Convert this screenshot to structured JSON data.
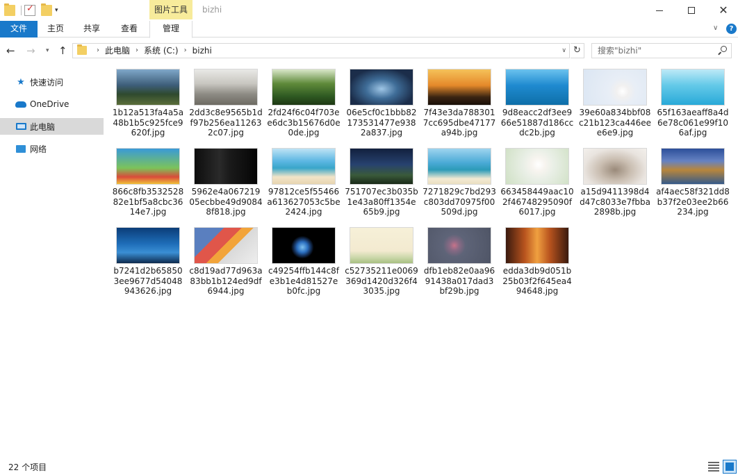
{
  "titlebar": {
    "context_tab": "图片工具",
    "title": "bizhi"
  },
  "ribbon": {
    "tabs": [
      "文件",
      "主页",
      "共享",
      "查看",
      "管理"
    ]
  },
  "address": {
    "crumbs": [
      "此电脑",
      "系统 (C:)",
      "bizhi"
    ],
    "search_placeholder": "搜索\"bizhi\""
  },
  "navpane": {
    "items": [
      "快速访问",
      "OneDrive",
      "此电脑",
      "网络"
    ],
    "selected": "此电脑"
  },
  "files": [
    {
      "name": "1b12a513fa4a5a48b1b5c925fce9620f.jpg"
    },
    {
      "name": "2dd3c8e9565b1df97b256ea112632c07.jpg"
    },
    {
      "name": "2fd24f6c04f703ee6dc3b15676d0e0de.jpg"
    },
    {
      "name": "06e5cf0c1bbb82173531477e9382a837.jpg"
    },
    {
      "name": "7f43e3da7883017cc695dbe47177a94b.jpg"
    },
    {
      "name": "9d8eacc2df3ee966e51887d186ccdc2b.jpg"
    },
    {
      "name": "39e60a834bbf08c21b123ca446eee6e9.jpg"
    },
    {
      "name": "65f163aeaff8a4d6e78c061e99f106af.jpg"
    },
    {
      "name": "866c8fb353252882e1bf5a8cbc3614e7.jpg"
    },
    {
      "name": "5962e4a06721905ecbbe49d90848f818.jpg"
    },
    {
      "name": "97812ce5f55466a613627053c5be2424.jpg"
    },
    {
      "name": "751707ec3b035b1e43a80ff1354e65b9.jpg"
    },
    {
      "name": "7271829c7bd293c803dd70975f00509d.jpg"
    },
    {
      "name": "663458449aac102f46748295090f6017.jpg"
    },
    {
      "name": "a15d9411398d4d47c8033e7fbba2898b.jpg"
    },
    {
      "name": "af4aec58f321dd8b37f2e03ee2b66234.jpg"
    },
    {
      "name": "b7241d2b658503ee9677d54048943626.jpg"
    },
    {
      "name": "c8d19ad77d963a83bb1b124ed9df6944.jpg"
    },
    {
      "name": "c49254ffb144c8fe3b1e4d81527eb0fc.jpg"
    },
    {
      "name": "c52735211e0069369d1420d326f43035.jpg"
    },
    {
      "name": "dfb1eb82e0aa9691438a017dad3bf29b.jpg"
    },
    {
      "name": "edda3db9d051b25b03f2f645ea494648.jpg"
    }
  ],
  "status": {
    "item_count": "22 个项目"
  },
  "colors": {
    "accent": "#1979ca",
    "context_tab": "#f7eb9b"
  }
}
